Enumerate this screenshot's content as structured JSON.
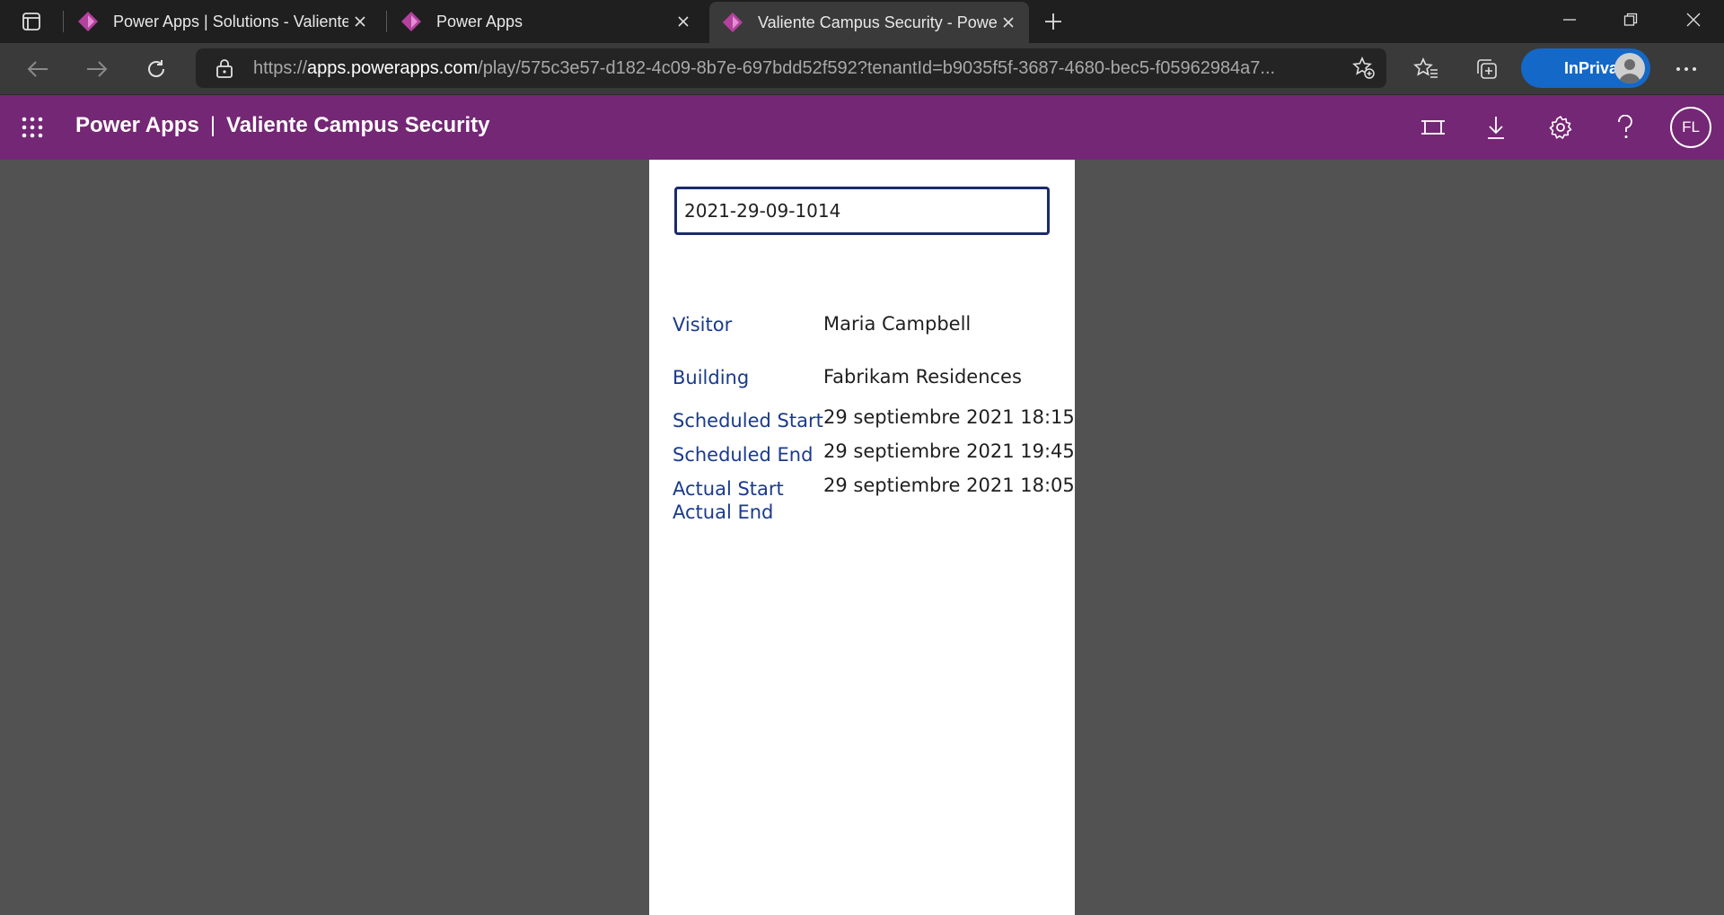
{
  "browser": {
    "tabs": [
      {
        "title": "Power Apps | Solutions - Valiente",
        "active": false
      },
      {
        "title": "Power Apps",
        "active": false
      },
      {
        "title": "Valiente Campus Security - Powe",
        "active": true
      }
    ],
    "url_prefix": "https://",
    "url_host": "apps.powerapps.com",
    "url_path": "/play/575c3e57-d182-4c09-8b7e-697bdd52f592?tenantId=b9035f5f-3687-4680-bec5-f05962984a7...",
    "inprivate_label": "InPrivate"
  },
  "header": {
    "product": "Power Apps",
    "separator": "|",
    "app_name": "Valiente Campus Security",
    "user_initials": "FL",
    "brand_color": "#742774"
  },
  "form": {
    "search_value": "2021-29-09-1014",
    "fields": {
      "visitor_label": "Visitor",
      "visitor_value": "Maria Campbell",
      "building_label": "Building",
      "building_value": "Fabrikam Residences",
      "scheduled_start_label": "Scheduled Start",
      "scheduled_start_value": "29 septiembre 2021 18:15",
      "scheduled_end_label": "Scheduled End",
      "scheduled_end_value": "29 septiembre 2021 19:45",
      "actual_start_label": "Actual Start",
      "actual_start_value": "29 septiembre 2021 18:05",
      "actual_end_label": "Actual End",
      "actual_end_value": ""
    }
  }
}
